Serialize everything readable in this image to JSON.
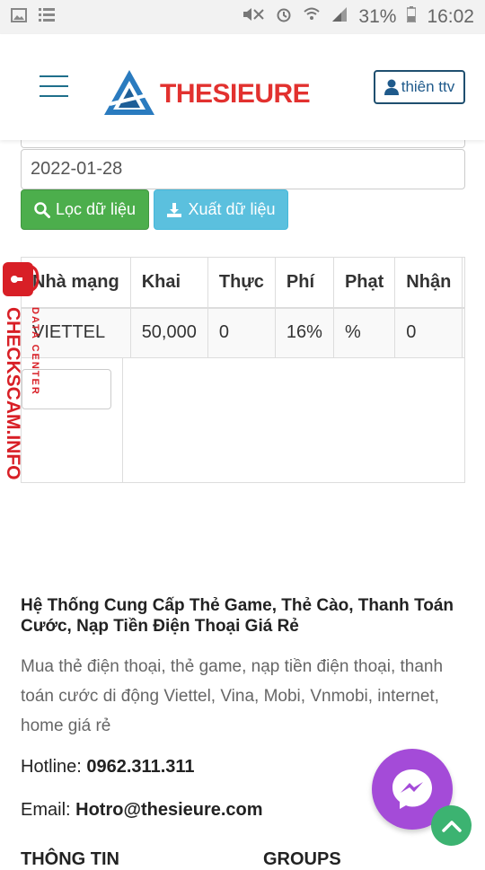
{
  "status_bar": {
    "battery": "31%",
    "time": "16:02",
    "left_icons": [
      "image-icon",
      "list-icon"
    ],
    "right_icons": [
      "mute-icon",
      "alarm-icon",
      "wifi-icon",
      "signal-icon",
      "battery-icon"
    ]
  },
  "header": {
    "logo_text": "THESIEURE",
    "user_button_label": "thiên ttv"
  },
  "filter": {
    "date_value": "2022-01-28",
    "filter_button": "Lọc dữ liệu",
    "export_button": "Xuất dữ liệu"
  },
  "table": {
    "headers": [
      "Nhà mạng",
      "Khai",
      "Thực",
      "Phí",
      "Phạt",
      "Nhận"
    ],
    "rows": [
      [
        "VIETTEL",
        "50,000",
        "0",
        "16%",
        "%",
        "0"
      ]
    ]
  },
  "watermark": {
    "brand": "CHECKSCAM.INFO",
    "subtitle": "DATA CENTER"
  },
  "footer": {
    "title": "Hệ Thống Cung Cấp Thẻ Game, Thẻ Cào, Thanh Toán Cước, Nạp Tiền Điện Thoại Giá Rẻ",
    "description": "Mua thẻ điện thoại, thẻ game, nạp tiền điện thoại, thanh toán cước di động Viettel, Vina, Mobi, Vnmobi, internet, home giá rẻ",
    "hotline_label": "Hotline: ",
    "hotline_value": "0962.311.311",
    "email_label": "Email: ",
    "email_value": "Hotro@thesieure.com",
    "col1_heading": "THÔNG TIN",
    "col2_heading": "GROUPS"
  },
  "colors": {
    "brand_red": "#e2312f",
    "brand_blue": "#1f5a8b",
    "green_button": "#4cae4c",
    "blue_button": "#5bc0de",
    "messenger": "#a44bd8",
    "watermark_red": "#d81f26"
  }
}
